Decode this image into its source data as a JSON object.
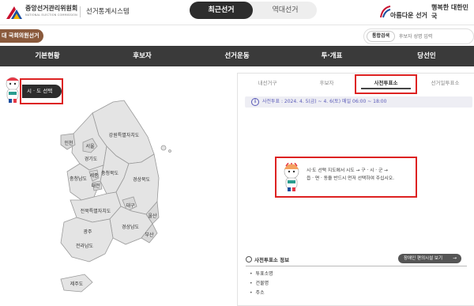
{
  "header": {
    "org_name": "중앙선거관리위원회",
    "org_sub": "NATIONAL ELECTION COMMISSION",
    "system_name": "선거통계시스템",
    "tabs": [
      {
        "label": "최근선거",
        "active": true
      },
      {
        "label": "역대선거",
        "active": false
      }
    ],
    "slogan_1": "아름다운 선거",
    "slogan_2": "행복한 대한민국"
  },
  "subheader": {
    "election_label": "대 국회의원선거",
    "search_button": "통합검색",
    "search_placeholder": "후보자 성명 입력"
  },
  "nav": [
    "기본현황",
    "후보자",
    "선거운동",
    "투·개표",
    "당선인"
  ],
  "left": {
    "sido_button": "시 · 도 선택",
    "regions": {
      "incheon": "인천",
      "seoul": "서울",
      "gyeonggi": "경기도",
      "gangwon": "강원특별자치도",
      "chungnam": "충청남도",
      "sejong": "세종",
      "daejeon": "대전",
      "chungbuk": "충청북도",
      "gyeongbuk": "경상북도",
      "daegu": "대구",
      "jeonbuk": "전북특별자치도",
      "ulsan": "울산",
      "gwangju": "광주",
      "gyeongnam": "경상남도",
      "busan": "부산",
      "jeonnam": "전라남도",
      "jeju": "제주도"
    }
  },
  "right": {
    "tabs": [
      {
        "label": "내선거구",
        "active": false
      },
      {
        "label": "후보자",
        "active": false
      },
      {
        "label": "사전투표소",
        "active": true
      },
      {
        "label": "선거일투표소",
        "active": false
      }
    ],
    "notice": "사전투표 : 2024. 4. 5(금) ~ 4. 6(토) 매일 06:00 ~ 18:00",
    "message_line1": "시·도 선택 지도에서 시도 → 구 · 시 · 군 →",
    "message_line2": "읍 · 면 · 동을 반드시 먼저 선택하여 주십시오.",
    "info_title": "사전투표소 정보",
    "facility_button": "장애인 편의시설 보기",
    "info_items": [
      "투표소명",
      "건물명",
      "주소"
    ]
  },
  "colors": {
    "nav_bg": "#3a3a3a",
    "badge_brown": "#8a5a3c",
    "notice_text": "#5b5bb8",
    "highlight_red": "#dd2222"
  }
}
